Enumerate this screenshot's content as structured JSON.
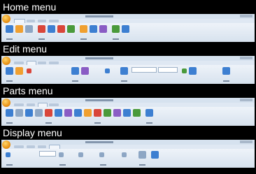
{
  "sections": [
    {
      "key": "home",
      "title": "Home menu"
    },
    {
      "key": "edit",
      "title": "Edit menu"
    },
    {
      "key": "parts",
      "title": "Parts menu"
    },
    {
      "key": "display",
      "title": "Display menu"
    }
  ],
  "colors": {
    "background": "#000000",
    "ribbon": "#d7e2ee",
    "accent_orb": "#e78f12",
    "icon_blue": "#3d7fd1",
    "icon_red": "#d9463a",
    "icon_green": "#4a9a3b",
    "icon_orange": "#f0a030",
    "icon_purple": "#8a5cc4"
  }
}
